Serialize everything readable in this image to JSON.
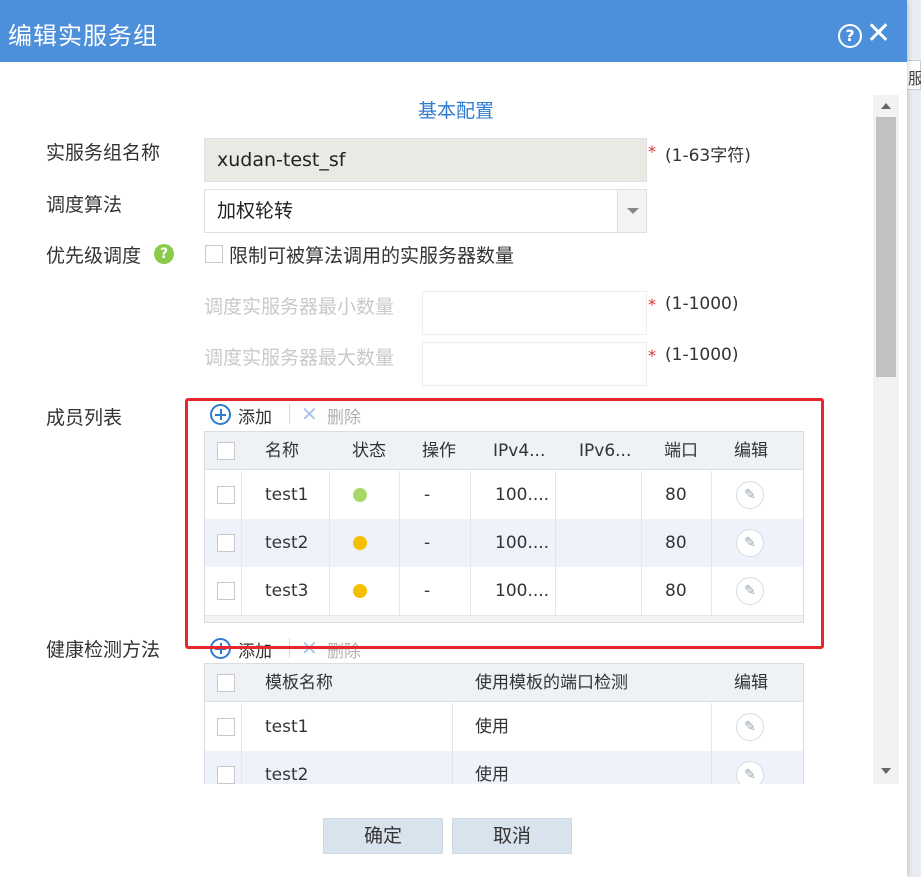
{
  "background": {
    "peek_text": "服"
  },
  "dialog": {
    "title": "编辑实服务组",
    "section_title": "基本配置",
    "fields": {
      "name_label": "实服务组名称",
      "name_value": "xudan-test_sf",
      "name_required": "*",
      "name_hint": "(1-63字符)",
      "algo_label": "调度算法",
      "algo_value": "加权轮转",
      "priority_label": "优先级调度",
      "priority_help": "?",
      "limit_checkbox_label": "限制可被算法调用的实服务器数量",
      "min_label": "调度实服务器最小数量",
      "min_required": "*",
      "min_hint": "(1-1000)",
      "max_label": "调度实服务器最大数量",
      "max_required": "*",
      "max_hint": "(1-1000)"
    },
    "members": {
      "label": "成员列表",
      "add": "添加",
      "delete": "删除",
      "columns": [
        "名称",
        "状态",
        "操作",
        "IPv4...",
        "IPv6...",
        "端口",
        "编辑"
      ],
      "rows": [
        {
          "name": "test1",
          "status": "green",
          "op": "-",
          "ipv4": "100....",
          "ipv6": "",
          "port": "80"
        },
        {
          "name": "test2",
          "status": "yellow",
          "op": "-",
          "ipv4": "100....",
          "ipv6": "",
          "port": "80"
        },
        {
          "name": "test3",
          "status": "yellow",
          "op": "-",
          "ipv4": "100....",
          "ipv6": "",
          "port": "80"
        }
      ]
    },
    "health": {
      "label": "健康检测方法",
      "add": "添加",
      "delete": "删除",
      "columns": [
        "模板名称",
        "使用模板的端口检测",
        "编辑"
      ],
      "rows": [
        {
          "name": "test1",
          "usage": "使用"
        },
        {
          "name": "test2",
          "usage": "使用"
        }
      ]
    },
    "buttons": {
      "ok": "确定",
      "cancel": "取消"
    }
  },
  "colors": {
    "titlebar": "#4c8fdb",
    "status_green": "#a6d96a",
    "status_yellow": "#f5c000",
    "highlight": "#e8262b"
  }
}
